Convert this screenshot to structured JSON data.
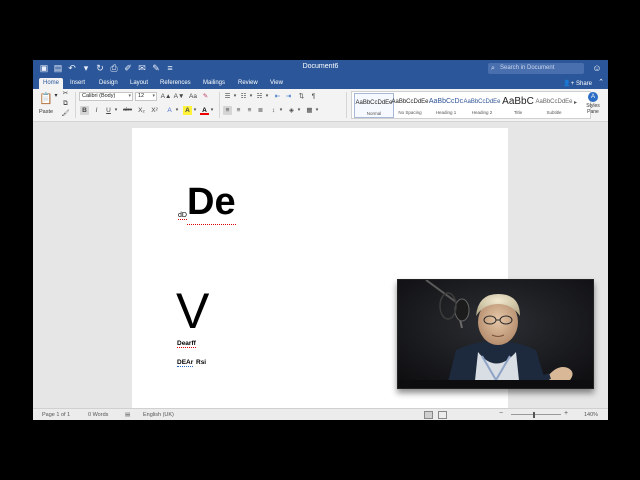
{
  "window": {
    "title": "Document6",
    "search_placeholder": "Search in Document"
  },
  "qat": {
    "icons": [
      "sidebar-icon",
      "save-icon",
      "undo-icon",
      "redo-icon",
      "print-icon",
      "format-painter-icon",
      "envelope-icon",
      "edit-icon",
      "customize-icon"
    ]
  },
  "tabs": [
    {
      "label": "Home",
      "active": true
    },
    {
      "label": "Insert"
    },
    {
      "label": "Design"
    },
    {
      "label": "Layout"
    },
    {
      "label": "References"
    },
    {
      "label": "Mailings"
    },
    {
      "label": "Review"
    },
    {
      "label": "View"
    }
  ],
  "share_label": "Share",
  "ribbon": {
    "paste_label": "Paste",
    "font_name": "Calibri (Body)",
    "font_size": "12",
    "bold": "B",
    "italic": "I",
    "underline": "U",
    "strikethrough": "abc",
    "subscript": "X₂",
    "superscript": "X²",
    "grow_font": "A▲",
    "shrink_font": "A▼",
    "change_case": "Aa",
    "font_color_glyph": "A",
    "highlight_glyph": "A"
  },
  "styles": [
    {
      "preview": "AaBbCcDdEe",
      "name": "Normal",
      "selected": true
    },
    {
      "preview": "AaBbCcDdEe",
      "name": "No Spacing"
    },
    {
      "preview": "AaBbCcDc",
      "name": "Heading 1"
    },
    {
      "preview": "AaBbCcDdEe",
      "name": "Heading 2"
    },
    {
      "preview": "AaBbC",
      "name": "Title"
    },
    {
      "preview": "AaBbCcDdEe",
      "name": "Subtitle"
    }
  ],
  "styles_pane_label": "Styles\nPane",
  "document": {
    "line1_small": "dD",
    "line1_large": "De",
    "line2": "V",
    "line3": "Dearff",
    "line4_a": "DEAr",
    "line4_b": "Rsi"
  },
  "status": {
    "page": "Page 1 of 1",
    "words": "0 Words",
    "language": "English (UK)",
    "zoom": "140%",
    "zoom_fraction": 0.45
  },
  "colors": {
    "title_bar": "#2b579a",
    "ribbon": "#f3f3f3",
    "canvas": "#e6e6e6",
    "accent": "#2b579a"
  }
}
